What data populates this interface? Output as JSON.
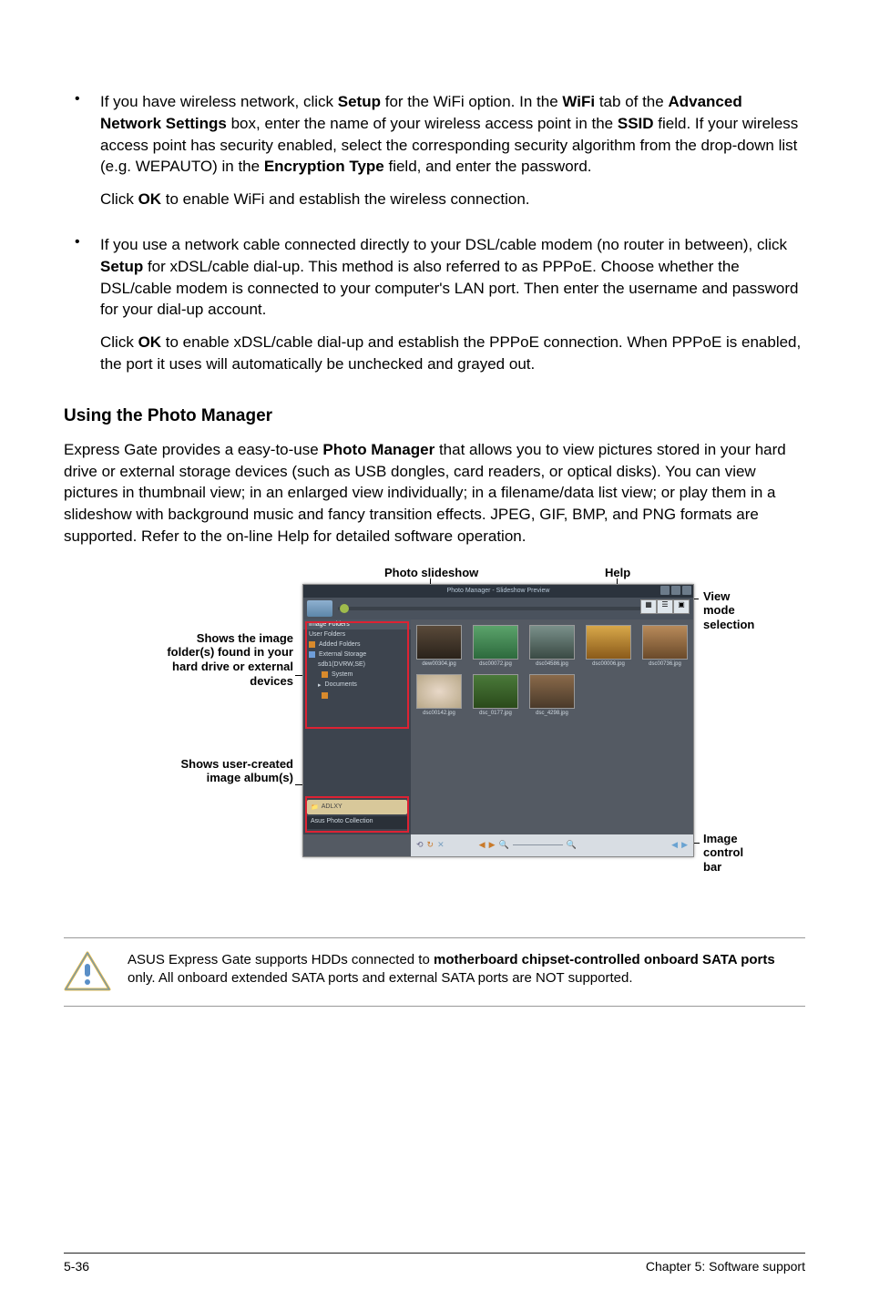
{
  "bullets": [
    {
      "para1_parts": [
        {
          "t": "If you have wireless network, click "
        },
        {
          "t": "Setup",
          "b": true
        },
        {
          "t": " for the WiFi option. In the "
        },
        {
          "t": "WiFi",
          "b": true
        },
        {
          "t": " tab of the "
        },
        {
          "t": "Advanced Network Settings",
          "b": true
        },
        {
          "t": " box, enter the name of your wireless access point in the "
        },
        {
          "t": "SSID",
          "b": true
        },
        {
          "t": " field. If your wireless access point has security enabled, select the corresponding security algorithm from the drop-down list (e.g. WEPAUTO) in the "
        },
        {
          "t": "Encryption Type",
          "b": true
        },
        {
          "t": " field, and enter the password."
        }
      ],
      "para2_parts": [
        {
          "t": "Click "
        },
        {
          "t": "OK",
          "b": true
        },
        {
          "t": " to enable WiFi and establish the wireless connection."
        }
      ]
    },
    {
      "para1_parts": [
        {
          "t": "If you use a network cable connected directly to your DSL/cable modem (no router in between), click "
        },
        {
          "t": "Setup",
          "b": true
        },
        {
          "t": " for xDSL/cable dial-up. This method is also referred to as PPPoE. Choose whether the DSL/cable modem is connected to your computer's LAN port. Then enter the username and password for your dial-up account."
        }
      ],
      "para2_parts": [
        {
          "t": "Click "
        },
        {
          "t": "OK",
          "b": true
        },
        {
          "t": " to enable xDSL/cable dial-up and establish the PPPoE connection. When PPPoE is enabled, the port it uses will automatically be unchecked and grayed out."
        }
      ]
    }
  ],
  "heading": "Using the Photo Manager",
  "body_parts": [
    {
      "t": "Express Gate  provides a easy-to-use "
    },
    {
      "t": "Photo Manager",
      "b": true
    },
    {
      "t": " that allows you to view pictures stored in your hard drive or external storage devices (such as USB dongles, card readers, or optical disks). You can view pictures in thumbnail view; in an enlarged view individually; in a filename/data list view; or play them in a slideshow with background music and fancy transition effects. JPEG, GIF, BMP, and PNG formats are supported. Refer to the on-line Help for detailed software operation."
    }
  ],
  "figure": {
    "labels": {
      "photo_slideshow": "Photo slideshow",
      "help": "Help",
      "viewmode": "View mode selection",
      "folders": "Shows the image folder(s) found in your hard drive or external devices",
      "albums": "Shows user-created image album(s)",
      "controlbar": "Image control bar"
    },
    "app": {
      "title": "Photo Manager - Slideshow Preview",
      "pane": {
        "image_folders": "Image Folders",
        "user_folders": "User Folders",
        "added_folders": "Added Folders",
        "external_storage": "External Storage",
        "external_item": "sdb1(DVRW,SE)",
        "system": "System",
        "documents": "Documents",
        "album": "ADLXY",
        "album_dark": "Asus Photo Collection"
      },
      "thumbs": [
        "dew00304.jpg",
        "dsc00072.jpg",
        "dsc04586.jpg",
        "dsc00006.jpg",
        "dsc00736.jpg",
        "dsc00142.jpg",
        "dsc_0177.jpg",
        "dsc_4298.jpg"
      ]
    }
  },
  "callout_parts": [
    {
      "t": "ASUS Express Gate supports HDDs connected to "
    },
    {
      "t": "motherboard chipset-controlled onboard SATA ports",
      "b": true
    },
    {
      "t": " only. All onboard extended SATA ports and external SATA ports are NOT supported."
    }
  ],
  "footer": {
    "left": "5-36",
    "right": "Chapter 5: Software support"
  }
}
